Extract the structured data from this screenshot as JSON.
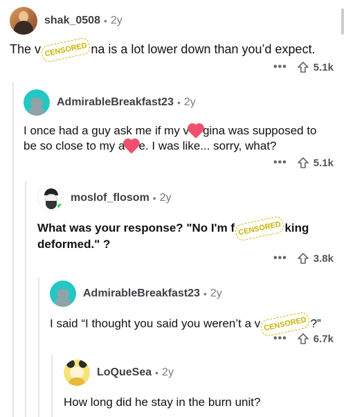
{
  "comments": [
    {
      "username": "shak_0508",
      "age": "2y",
      "text_before": "The v",
      "censor": "CENSORED",
      "text_after": "na is a lot lower down than you’d expect.",
      "more": "•••",
      "votes": "5.1k"
    },
    {
      "username": "AdmirableBreakfast23",
      "age": "2y",
      "text_line1_before": "I once had a guy ask me if my v",
      "text_line1_after": "gina was supposed to",
      "text_line2_before": "be so close to my a",
      "text_line2_after": "e. I was like... sorry, what?",
      "more": "•••",
      "votes": "5.1k"
    },
    {
      "username": "moslof_flosom",
      "age": "2y",
      "text_line1_before": "What was your response? \"No I'm f",
      "text_line1_after": "king",
      "text_line2": "deformed.\" ?",
      "censor": "CENSORED",
      "more": "•••",
      "votes": "3.8k"
    },
    {
      "username": "AdmirableBreakfast23",
      "age": "2y",
      "text_before": "I said “I thought you said you weren’t a v",
      "censor": "CENSORED",
      "text_after": "?”",
      "more": "•••",
      "votes": "6.7k"
    },
    {
      "username": "LoQueSea",
      "age": "2y",
      "text": "How long did he stay in the burn unit?"
    }
  ],
  "separator": "•",
  "colors": {
    "teal_avatar": "#24c7c3",
    "heart": "#f0506e",
    "censor": "#c8b400"
  }
}
